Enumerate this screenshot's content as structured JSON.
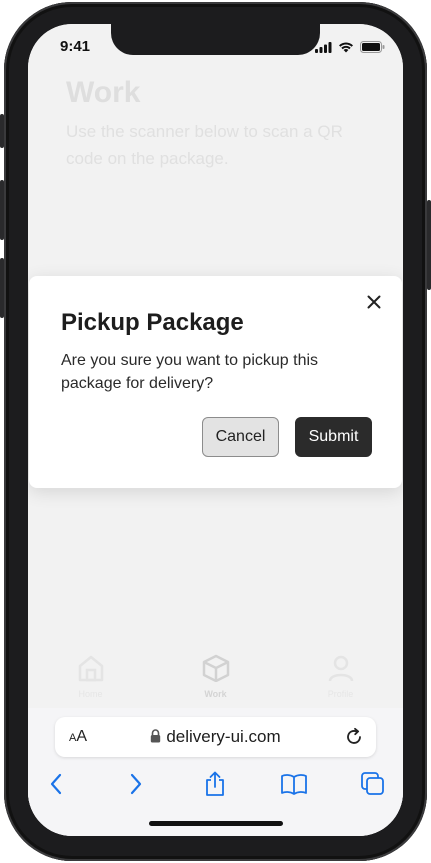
{
  "status_bar": {
    "time": "9:41"
  },
  "page": {
    "title": "Work",
    "description": "Use the scanner below to scan a QR code on the package."
  },
  "tab_bar": {
    "items": [
      {
        "label": "Home",
        "icon": "home-icon"
      },
      {
        "label": "Work",
        "icon": "package-icon"
      },
      {
        "label": "Profile",
        "icon": "user-icon"
      }
    ]
  },
  "modal": {
    "title": "Pickup Package",
    "body": "Are you sure you want to pickup this package for delivery?",
    "cancel_label": "Cancel",
    "submit_label": "Submit"
  },
  "browser": {
    "text_size_label": "AA",
    "url": "delivery-ui.com",
    "accent_color": "#1a73e8"
  }
}
